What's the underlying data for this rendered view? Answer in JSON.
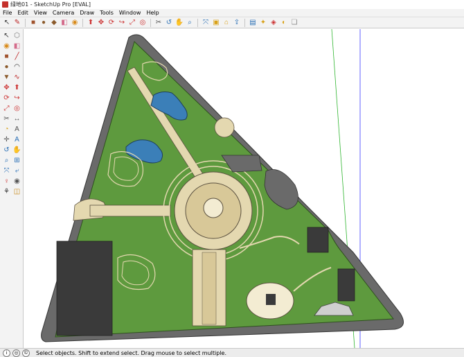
{
  "window": {
    "title": "绿地01 - SketchUp Pro [EVAL]"
  },
  "menu": [
    "File",
    "Edit",
    "View",
    "Camera",
    "Draw",
    "Tools",
    "Window",
    "Help"
  ],
  "toolbar": [
    {
      "icon": "select-icon",
      "glyph": "↖",
      "color": "#333"
    },
    {
      "icon": "pencil-icon",
      "glyph": "✎",
      "color": "#b22"
    },
    {
      "icon": "rectangle-icon",
      "glyph": "■",
      "color": "#a0522d"
    },
    {
      "icon": "circle-icon",
      "glyph": "●",
      "color": "#8b5a2b"
    },
    {
      "icon": "polygon-icon",
      "glyph": "◆",
      "color": "#8b5a2b"
    },
    {
      "icon": "eraser-icon",
      "glyph": "◧",
      "color": "#d46a8a"
    },
    {
      "icon": "paint-bucket-icon",
      "glyph": "◉",
      "color": "#d88a1a"
    },
    {
      "icon": "push-pull-icon",
      "glyph": "⬆",
      "color": "#c33"
    },
    {
      "icon": "move-icon",
      "glyph": "✥",
      "color": "#c33"
    },
    {
      "icon": "rotate-icon",
      "glyph": "⟳",
      "color": "#c33"
    },
    {
      "icon": "follow-me-icon",
      "glyph": "↪",
      "color": "#c33"
    },
    {
      "icon": "scale-icon",
      "glyph": "⤢",
      "color": "#c33"
    },
    {
      "icon": "offset-icon",
      "glyph": "◎",
      "color": "#c33"
    },
    {
      "icon": "tape-measure-icon",
      "glyph": "✂",
      "color": "#555"
    },
    {
      "icon": "orbit-icon",
      "glyph": "↺",
      "color": "#2a6fb5"
    },
    {
      "icon": "pan-icon",
      "glyph": "✋",
      "color": "#2a6fb5"
    },
    {
      "icon": "zoom-icon",
      "glyph": "⌕",
      "color": "#2a6fb5"
    },
    {
      "icon": "zoom-extents-icon",
      "glyph": "⤧",
      "color": "#2a6fb5"
    },
    {
      "icon": "components-icon",
      "glyph": "▣",
      "color": "#d9a21a"
    },
    {
      "icon": "warehouse-icon",
      "glyph": "⌂",
      "color": "#d9a21a"
    },
    {
      "icon": "share-model-icon",
      "glyph": "⇪",
      "color": "#2a6fb5"
    },
    {
      "icon": "layout-icon",
      "glyph": "▤",
      "color": "#2a6fb5"
    },
    {
      "icon": "extension-icon",
      "glyph": "✦",
      "color": "#d9a21a"
    },
    {
      "icon": "ruby-icon",
      "glyph": "◈",
      "color": "#c33"
    },
    {
      "icon": "style-icon",
      "glyph": "◐",
      "color": "#d9a21a"
    },
    {
      "icon": "scene-icon",
      "glyph": "❏",
      "color": "#888"
    }
  ],
  "lefttools": [
    {
      "icon": "select-icon",
      "glyph": "↖",
      "color": "#333"
    },
    {
      "icon": "make-component-icon",
      "glyph": "⬡",
      "color": "#777"
    },
    {
      "icon": "paint-bucket-icon",
      "glyph": "◉",
      "color": "#d88a1a"
    },
    {
      "icon": "eraser-icon",
      "glyph": "◧",
      "color": "#d46a8a"
    },
    {
      "icon": "rectangle-icon",
      "glyph": "■",
      "color": "#a0522d"
    },
    {
      "icon": "line-icon",
      "glyph": "╱",
      "color": "#b22"
    },
    {
      "icon": "circle-icon",
      "glyph": "●",
      "color": "#8b5a2b"
    },
    {
      "icon": "arc-icon",
      "glyph": "◠",
      "color": "#333"
    },
    {
      "icon": "polygon-icon",
      "glyph": "▼",
      "color": "#8b5a2b"
    },
    {
      "icon": "freehand-icon",
      "glyph": "∿",
      "color": "#b22"
    },
    {
      "icon": "move-icon",
      "glyph": "✥",
      "color": "#c33"
    },
    {
      "icon": "push-pull-icon",
      "glyph": "⬆",
      "color": "#c33"
    },
    {
      "icon": "rotate-icon",
      "glyph": "⟳",
      "color": "#c33"
    },
    {
      "icon": "follow-me-icon",
      "glyph": "↪",
      "color": "#c33"
    },
    {
      "icon": "scale-icon",
      "glyph": "⤢",
      "color": "#c33"
    },
    {
      "icon": "offset-icon",
      "glyph": "◎",
      "color": "#c33"
    },
    {
      "icon": "tape-measure-icon",
      "glyph": "✂",
      "color": "#555"
    },
    {
      "icon": "dimension-icon",
      "glyph": "↔",
      "color": "#555"
    },
    {
      "icon": "protractor-icon",
      "glyph": "◔",
      "color": "#d9a21a"
    },
    {
      "icon": "text-icon",
      "glyph": "A",
      "color": "#555"
    },
    {
      "icon": "axes-icon",
      "glyph": "✛",
      "color": "#555"
    },
    {
      "icon": "3d-text-icon",
      "glyph": "A",
      "color": "#2a6fb5"
    },
    {
      "icon": "orbit-icon",
      "glyph": "↺",
      "color": "#2a6fb5"
    },
    {
      "icon": "pan-icon",
      "glyph": "✋",
      "color": "#2a6fb5"
    },
    {
      "icon": "zoom-icon",
      "glyph": "⌕",
      "color": "#2a6fb5"
    },
    {
      "icon": "zoom-window-icon",
      "glyph": "⊞",
      "color": "#2a6fb5"
    },
    {
      "icon": "zoom-extents-icon",
      "glyph": "⤧",
      "color": "#2a6fb5"
    },
    {
      "icon": "previous-view-icon",
      "glyph": "⤶",
      "color": "#2a6fb5"
    },
    {
      "icon": "position-camera-icon",
      "glyph": "♀",
      "color": "#c33"
    },
    {
      "icon": "look-around-icon",
      "glyph": "◉",
      "color": "#555"
    },
    {
      "icon": "walk-icon",
      "glyph": "⚘",
      "color": "#333"
    },
    {
      "icon": "section-plane-icon",
      "glyph": "◫",
      "color": "#c88a1a"
    }
  ],
  "status": {
    "icons": [
      "info-icon",
      "geo-location-icon",
      "credits-icon"
    ],
    "text": "Select objects. Shift to extend select. Drag mouse to select multiple."
  },
  "colors": {
    "lawn": "#5e9a3e",
    "path": "#e4d8b0",
    "road": "#6a6a6a",
    "water": "#3b7fb8",
    "axis_green": "#2fb52f",
    "axis_blue": "#3a3aff"
  }
}
